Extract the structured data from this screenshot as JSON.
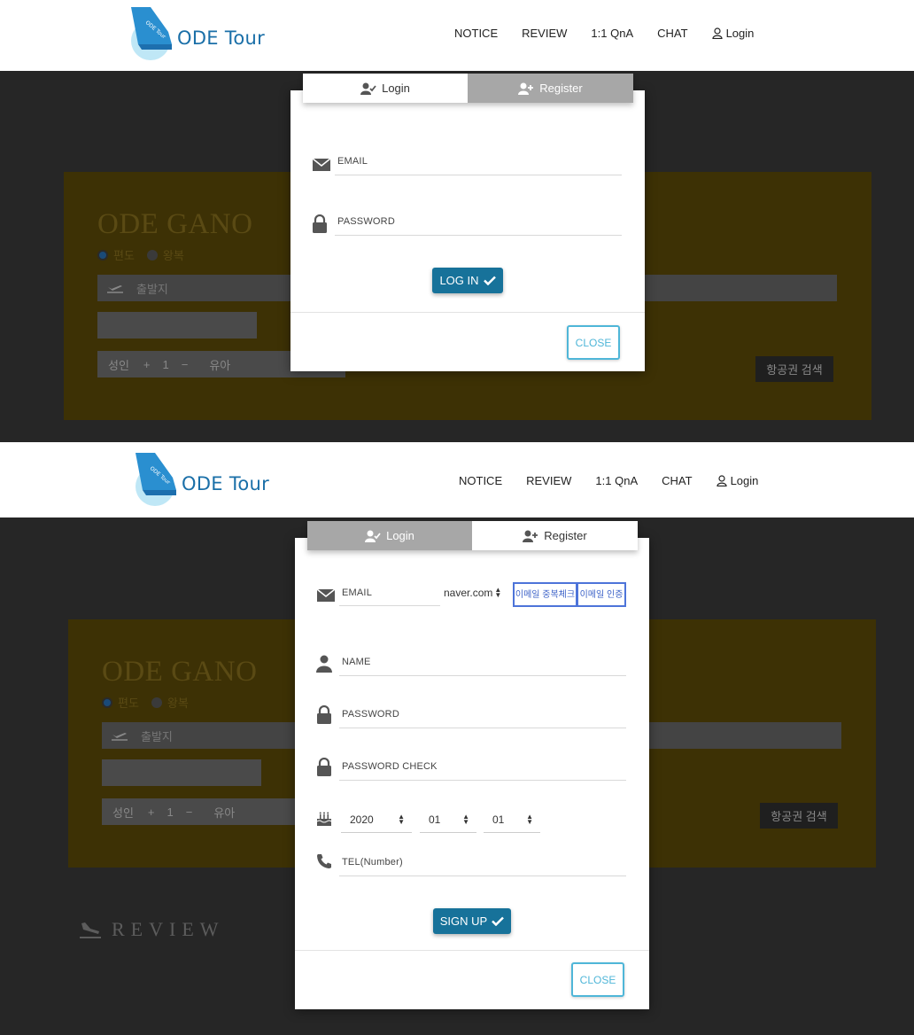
{
  "header": {
    "logo_text": "ODE Tour",
    "logo_badge": "ODE Tour",
    "nav": {
      "notice": "NOTICE",
      "review": "REVIEW",
      "qna": "1:1 QnA",
      "chat": "CHAT",
      "login": "Login"
    }
  },
  "background": {
    "hero_title": "ODE GANO",
    "trip_types": {
      "oneway": "편도",
      "roundtrip": "왕복"
    },
    "departure_placeholder": "출발지",
    "adult_label": "성인",
    "adult_count": "1",
    "child_label": "유아",
    "search_button": "항공권 검색",
    "review_heading": "REVIEW"
  },
  "login_modal": {
    "tabs": {
      "login": "Login",
      "register": "Register"
    },
    "active_tab": "login",
    "email_placeholder": "EMAIL",
    "password_placeholder": "PASSWORD",
    "submit_label": "LOG IN",
    "close_label": "CLOSE"
  },
  "register_modal": {
    "tabs": {
      "login": "Login",
      "register": "Register"
    },
    "active_tab": "register",
    "email_placeholder": "EMAIL",
    "email_domain": "naver.com",
    "dup_check_label": "이메일 중복체크",
    "verify_label": "이메일 인증",
    "name_placeholder": "NAME",
    "password_placeholder": "PASSWORD",
    "password_check_placeholder": "PASSWORD CHECK",
    "birth_year": "2020",
    "birth_month": "01",
    "birth_day": "01",
    "tel_placeholder": "TEL(Number)",
    "submit_label": "SIGN UP",
    "close_label": "CLOSE"
  },
  "colors": {
    "primary": "#17729a",
    "close_border": "#4fb6d8",
    "inactive_tab": "#a7a7a7",
    "overlay": "#262626"
  }
}
